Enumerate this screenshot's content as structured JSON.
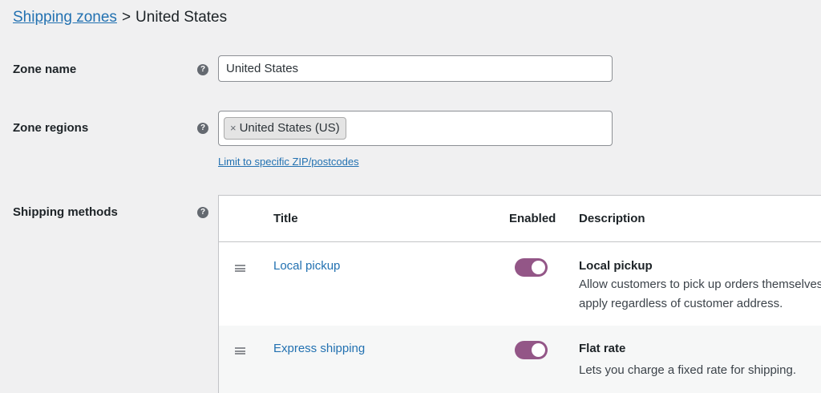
{
  "breadcrumb": {
    "parent_label": "Shipping zones",
    "separator": ">",
    "current_label": "United States"
  },
  "form": {
    "zone_name": {
      "label": "Zone name",
      "help": "?",
      "value": "United States"
    },
    "zone_regions": {
      "label": "Zone regions",
      "help": "?",
      "chips": [
        {
          "remove": "×",
          "label": "United States (US)"
        }
      ],
      "limit_link": "Limit to specific ZIP/postcodes"
    },
    "shipping_methods": {
      "label": "Shipping methods",
      "help": "?",
      "columns": {
        "title": "Title",
        "enabled": "Enabled",
        "description": "Description"
      },
      "rows": [
        {
          "title": "Local pickup",
          "enabled": true,
          "desc_title": "Local pickup",
          "desc_line1": "Allow customers to pick up orders themselves",
          "desc_line2": "apply regardless of customer address."
        },
        {
          "title": "Express shipping",
          "enabled": true,
          "desc_title": "Flat rate",
          "desc_line1": "Lets you charge a fixed rate for shipping.",
          "desc_line2": ""
        }
      ]
    }
  },
  "colors": {
    "link": "#2271b1",
    "toggle_on": "#935687",
    "background": "#f0f0f1"
  }
}
